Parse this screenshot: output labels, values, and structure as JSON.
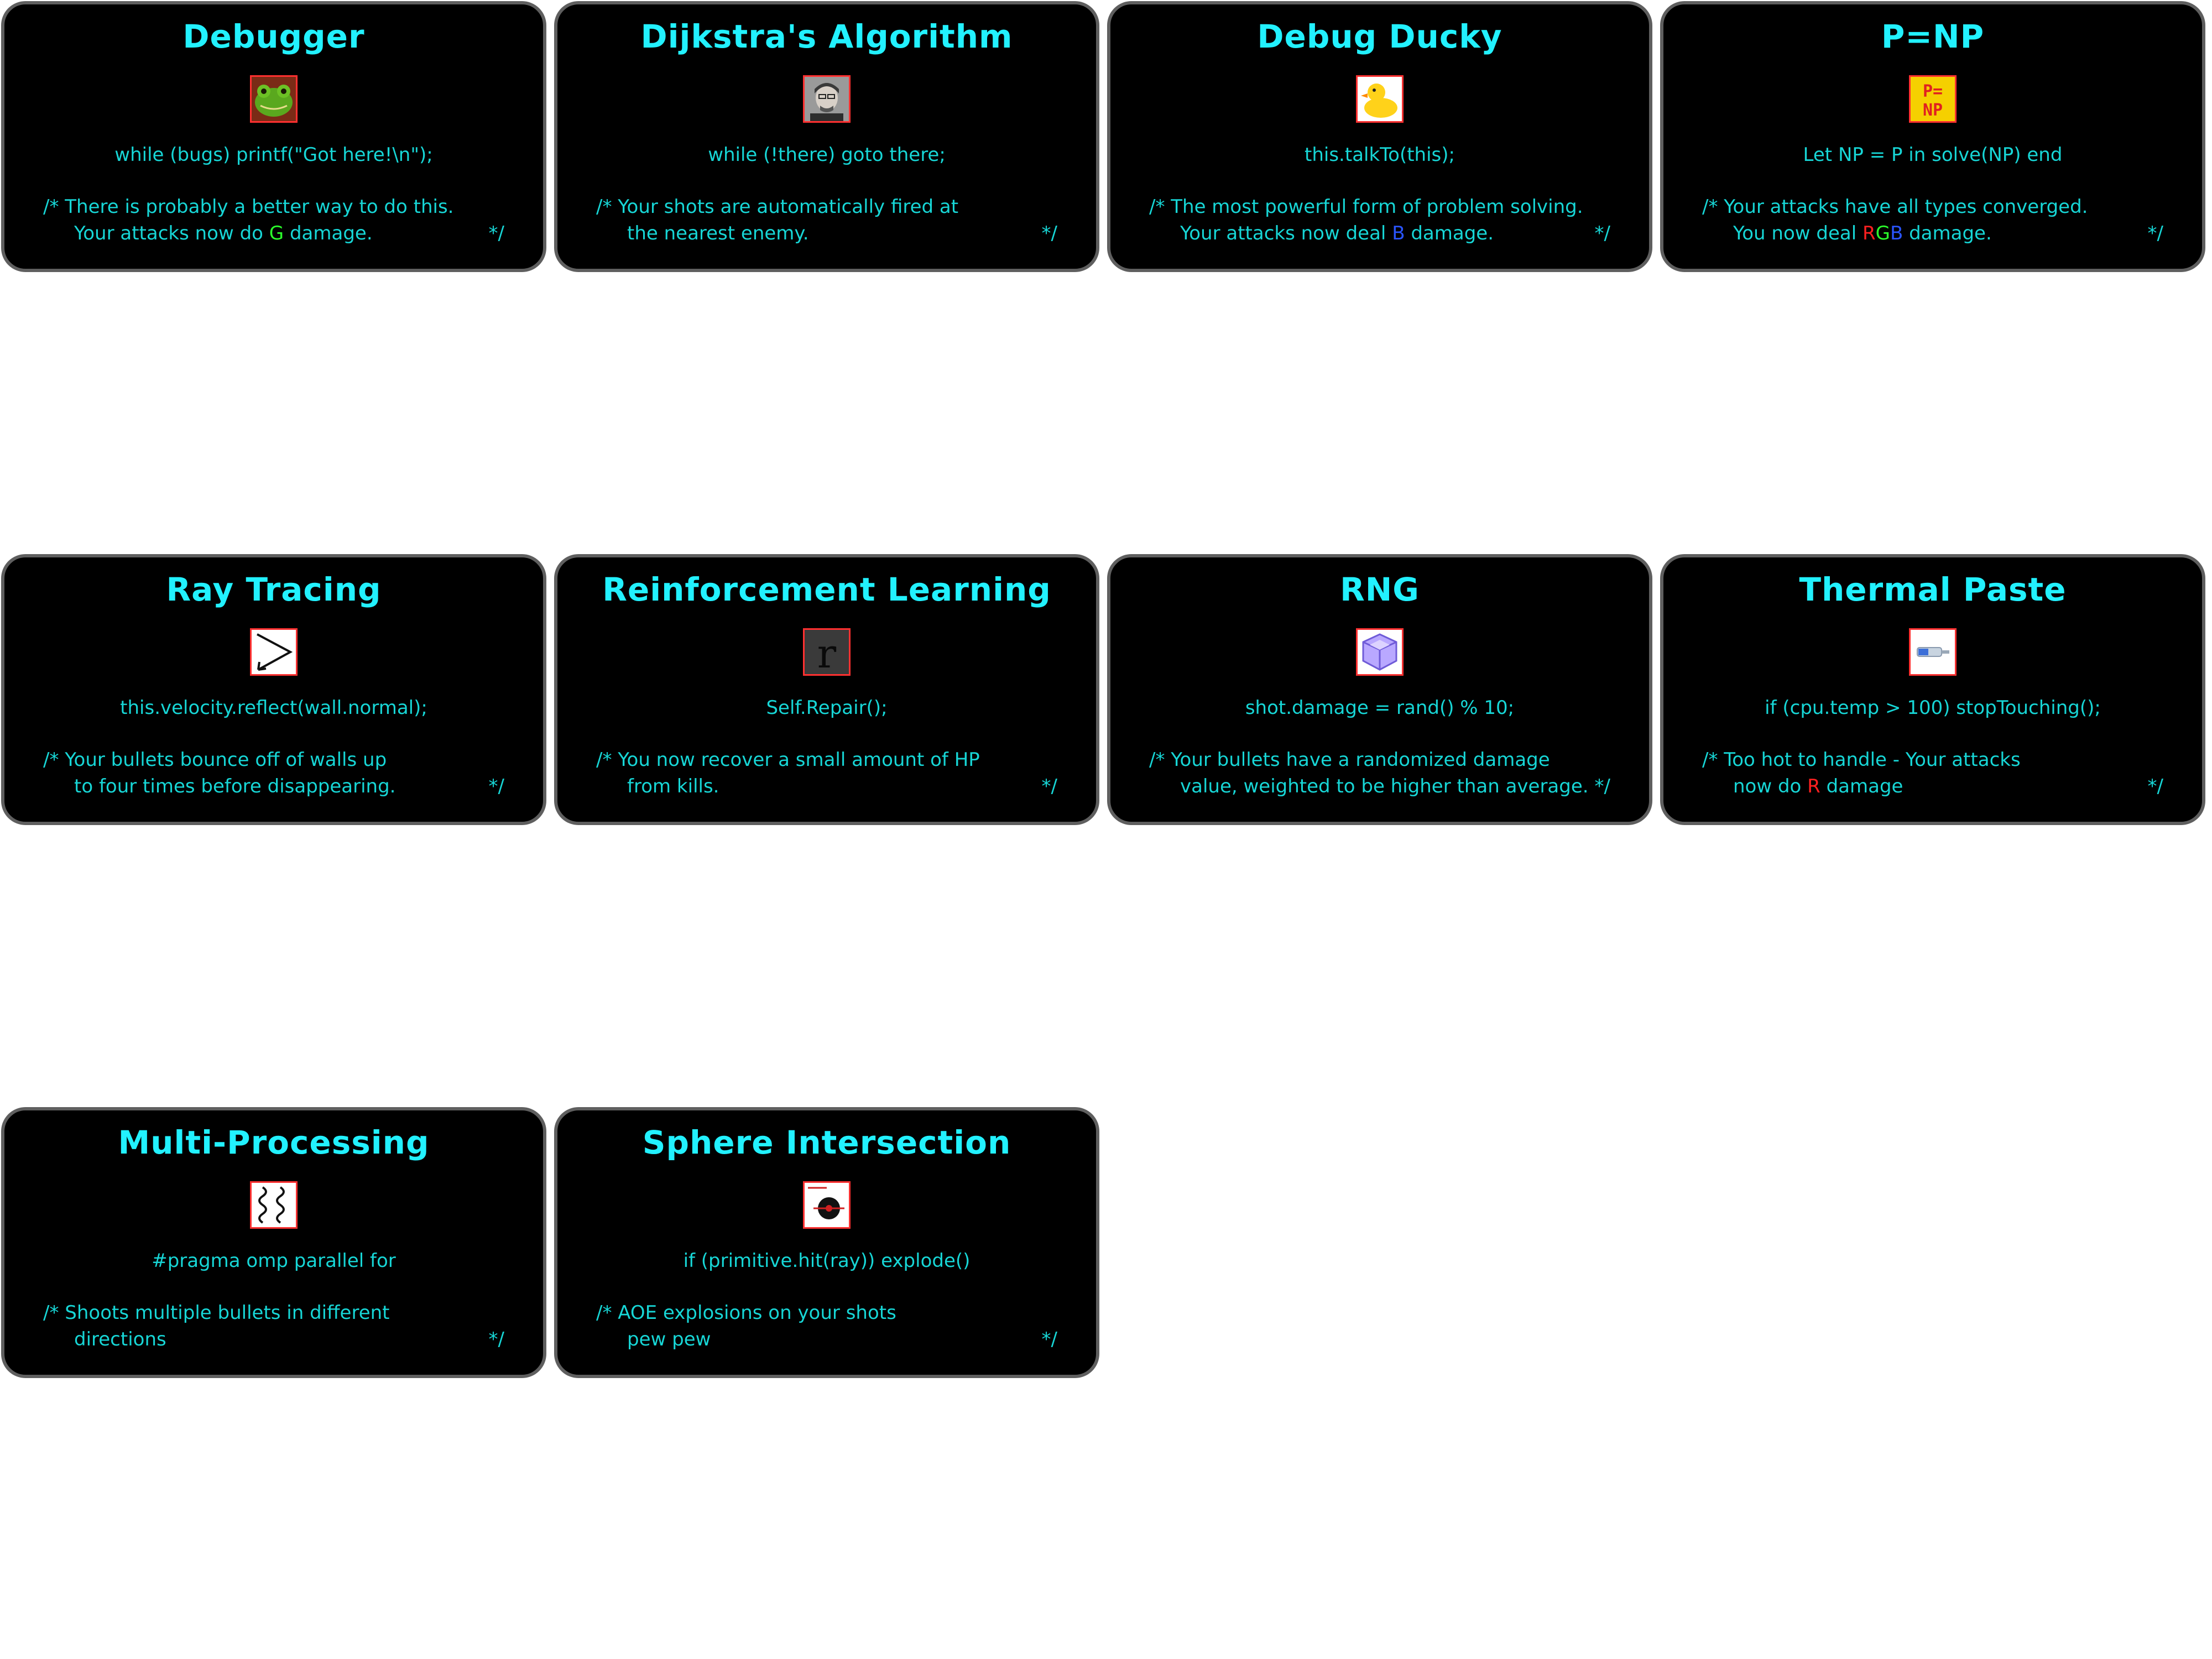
{
  "cards": [
    {
      "title": "Debugger",
      "icon": "frog-icon",
      "code": "while (bugs) printf(\"Got here!\\n\");",
      "comment_line1": "/* There is probably a better way to do this.",
      "comment_line2_before": "Your attacks now do ",
      "comment_line2_highlight": "G",
      "comment_line2_after": " damage.",
      "comment_end": "*/"
    },
    {
      "title": "Dijkstra's Algorithm",
      "icon": "portrait-icon",
      "code": "while (!there) goto there;",
      "comment_line1": "/* Your shots are automatically fired at",
      "comment_line2_before": "the nearest enemy.",
      "comment_line2_highlight": "",
      "comment_line2_after": "",
      "comment_end": "*/"
    },
    {
      "title": "Debug Ducky",
      "icon": "rubber-duck-icon",
      "code": "this.talkTo(this);",
      "comment_line1": "/* The most powerful form of problem solving.",
      "comment_line2_before": "Your attacks now deal ",
      "comment_line2_highlight": "B",
      "comment_line2_after": " damage.",
      "comment_end": "*/"
    },
    {
      "title": "P=NP",
      "icon": "p-equals-np-icon",
      "code": "Let NP = P in solve(NP) end",
      "comment_line1": "/* Your attacks have all types converged.",
      "comment_line2_before": "You now deal ",
      "comment_line2_rgb": [
        "R",
        "G",
        "B"
      ],
      "comment_line2_after": " damage.",
      "comment_end": "*/"
    },
    {
      "title": "Ray Tracing",
      "icon": "ray-reflection-icon",
      "code": "this.velocity.reflect(wall.normal);",
      "comment_line1": "/* Your bullets bounce off of walls up",
      "comment_line2_before": "to four times before disappearing.",
      "comment_line2_highlight": "",
      "comment_line2_after": "",
      "comment_end": "*/"
    },
    {
      "title": "Reinforcement Learning",
      "icon": "letter-r-icon",
      "code": "Self.Repair();",
      "comment_line1": "/* You now recover a small amount of HP",
      "comment_line2_before": "from kills.",
      "comment_line2_highlight": "",
      "comment_line2_after": "",
      "comment_end": "*/"
    },
    {
      "title": "RNG",
      "icon": "dice-cube-icon",
      "code": "shot.damage = rand() % 10;",
      "comment_line1": "/* Your bullets have a randomized damage",
      "comment_line2_before": "value, weighted to be higher than average.",
      "comment_line2_highlight": "",
      "comment_line2_after": "",
      "comment_end": "*/"
    },
    {
      "title": "Thermal Paste",
      "icon": "syringe-icon",
      "code": "if (cpu.temp > 100) stopTouching();",
      "comment_line1": "/* Too hot to handle - Your attacks",
      "comment_line2_before": "now do ",
      "comment_line2_highlight": "R",
      "comment_line2_after": " damage",
      "comment_end": "*/"
    },
    {
      "title": "Multi-Processing",
      "icon": "threads-icon",
      "code": "#pragma omp parallel for",
      "comment_line1": "/* Shoots multiple bullets in different",
      "comment_line2_before": "directions",
      "comment_line2_highlight": "",
      "comment_line2_after": "",
      "comment_end": "*/"
    },
    {
      "title": "Sphere Intersection",
      "icon": "sphere-target-icon",
      "code": "if (primitive.hit(ray)) explode()",
      "comment_line1": "/* AOE explosions on your shots",
      "comment_line2_before": "pew pew",
      "comment_line2_highlight": "",
      "comment_line2_after": "",
      "comment_end": "*/"
    }
  ]
}
